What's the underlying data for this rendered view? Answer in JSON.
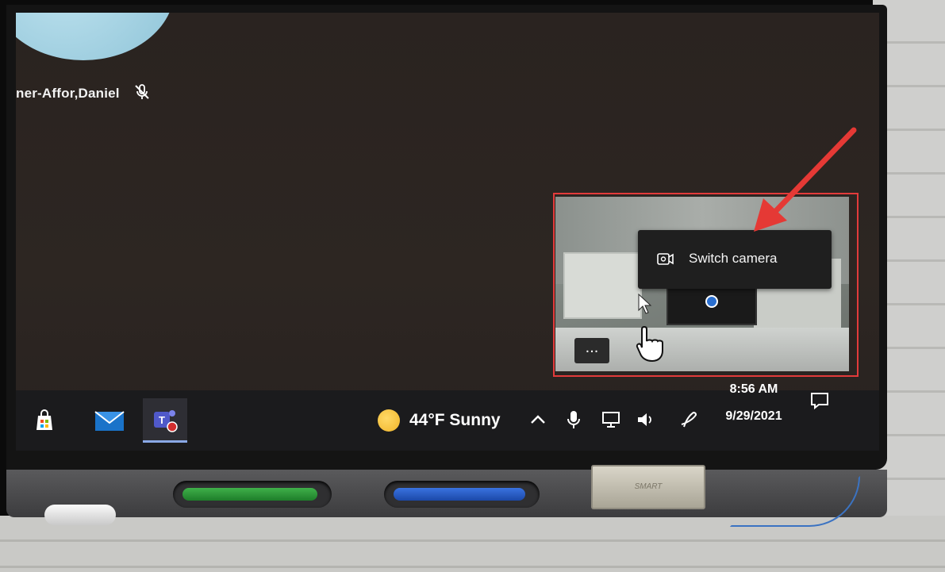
{
  "meeting": {
    "participant_name": "ner-Affor,Daniel",
    "mic_status_icon": "mic-off-icon"
  },
  "self_view": {
    "more_options_label": "...",
    "context_menu": {
      "items": [
        {
          "icon": "switch-camera-icon",
          "label": "Switch camera"
        }
      ]
    }
  },
  "taskbar": {
    "apps": [
      {
        "name": "microsoft-store",
        "icon": "store-icon",
        "active": false
      },
      {
        "name": "mail",
        "icon": "mail-icon",
        "active": false
      },
      {
        "name": "microsoft-teams",
        "icon": "teams-icon",
        "active": true
      }
    ],
    "weather": {
      "text": "44°F  Sunny",
      "icon": "sun-icon"
    },
    "tray_icons": [
      "chevron-up-icon",
      "microphone-icon",
      "display-icon",
      "volume-icon",
      "pen-icon"
    ],
    "clock": {
      "time": "8:56 AM",
      "date": "9/29/2021"
    },
    "notification_icon": "notification-icon"
  },
  "hardware": {
    "brand_plate": "SMART"
  },
  "annotation": {
    "highlight_color": "#e23b3b"
  }
}
